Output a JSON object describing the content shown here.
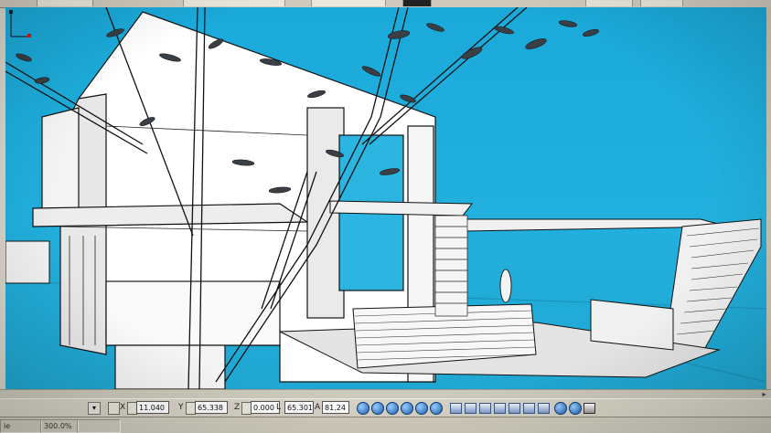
{
  "coordinates": {
    "x_label": "X",
    "x_value": "11.040",
    "y_label": "Y",
    "y_value": "65.338",
    "z_label": "Z",
    "z_value": "0.000",
    "l_label": "L",
    "l_value": "65.301",
    "a_label": "A",
    "a_value": "81.24"
  },
  "status": {
    "mode": "le modèle",
    "zoom": "300.0%"
  },
  "icons": {
    "viewport": "3d-model-view",
    "axis": "axis-indicator-icon",
    "zoom_in": "zoom-in-icon",
    "zoom_out": "zoom-out-icon",
    "pan": "pan-hand-icon",
    "orbit": "orbit-icon",
    "view": "view-preset-icon",
    "render": "render-icon"
  },
  "colors": {
    "viewport_background": "#1fadd9",
    "model_fill": "#ffffff",
    "model_edge": "#111111"
  }
}
